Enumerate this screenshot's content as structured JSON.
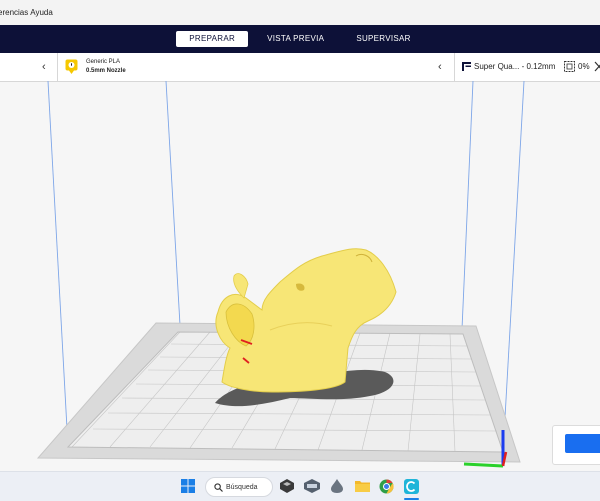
{
  "menu": {
    "items": [
      "erencias",
      "Ayuda"
    ]
  },
  "stages": [
    {
      "label": "PREPARAR",
      "active": true
    },
    {
      "label": "VISTA PREVIA",
      "active": false
    },
    {
      "label": "SUPERVISAR",
      "active": false
    }
  ],
  "material": {
    "name": "Generic PLA",
    "nozzle": "0.5mm Nozzle",
    "icon": "spool-warning-icon",
    "color": "#f6c800"
  },
  "print_settings": {
    "profile": "Super Qua... - 0.12mm",
    "infill": "0%"
  },
  "model": {
    "description_icon": "cat-head-model",
    "color": "#f7e676"
  },
  "taskbar": {
    "search_label": "Búsqueda",
    "apps": [
      "windows-start-icon",
      "search-icon",
      "app-icon-1",
      "app-icon-2",
      "app-icon-3",
      "folder-icon",
      "chrome-icon",
      "cura-icon"
    ]
  },
  "colors": {
    "accent": "#196ef0",
    "header_bg": "#0d1138",
    "axis_x": "#2bd12b",
    "axis_y": "#e02020",
    "axis_z": "#1b3cf0"
  }
}
